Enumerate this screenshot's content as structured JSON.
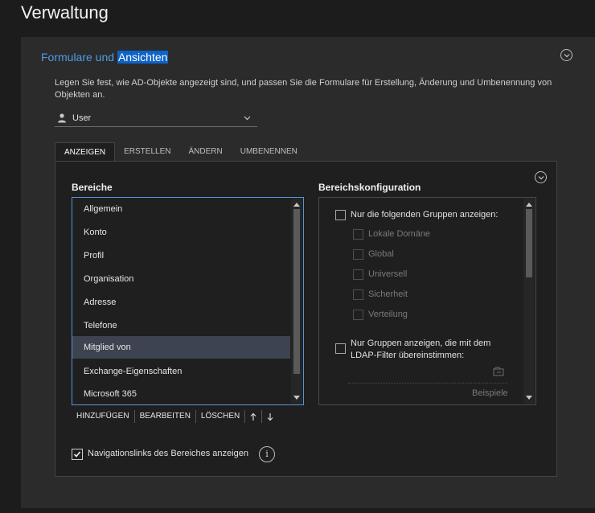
{
  "page": {
    "title": "Verwaltung"
  },
  "card": {
    "title_part1": "Formulare und ",
    "title_part2": "Ansichten",
    "description": "Legen Sie fest, wie AD-Objekte angezeigt sind, und passen Sie die Formulare für Erstellung, Änderung und Umbenennung von Objekten an.",
    "object_type": {
      "value": "User",
      "icon": "user-icon"
    }
  },
  "tabs": [
    {
      "label": "ANZEIGEN",
      "active": true
    },
    {
      "label": "ERSTELLEN",
      "active": false
    },
    {
      "label": "ÄNDERN",
      "active": false
    },
    {
      "label": "UMBENENNEN",
      "active": false
    }
  ],
  "sections": {
    "label": "Bereiche",
    "items": [
      {
        "label": "Allgemein",
        "selected": false
      },
      {
        "label": "Konto",
        "selected": false
      },
      {
        "label": "Profil",
        "selected": false
      },
      {
        "label": "Organisation",
        "selected": false
      },
      {
        "label": "Adresse",
        "selected": false
      },
      {
        "label": "Telefone",
        "selected": false
      },
      {
        "label": "Mitglied von",
        "selected": true
      },
      {
        "label": "Exchange-Eigenschaften",
        "selected": false
      },
      {
        "label": "Microsoft 365",
        "selected": false
      }
    ],
    "toolbar": {
      "add_label": "HINZUFÜGEN",
      "edit_label": "BEARBEITEN",
      "delete_label": "LÖSCHEN"
    }
  },
  "config": {
    "label": "Bereichskonfiguration",
    "only_groups_label": "Nur die folgenden Gruppen anzeigen:",
    "group_types": [
      {
        "label": "Lokale Domäne"
      },
      {
        "label": "Global"
      },
      {
        "label": "Universell"
      },
      {
        "label": "Sicherheit"
      },
      {
        "label": "Verteilung"
      }
    ],
    "ldap_label": "Nur Gruppen anzeigen, die mit dem LDAP-Filter übereinstimmen:",
    "examples_label": "Beispiele"
  },
  "navlinks": {
    "label": "Navigationslinks des Bereiches anzeigen",
    "checked": true
  },
  "colors": {
    "accent": "#4f9be8",
    "highlight": "#0e63c8",
    "selected_row": "#3d4350",
    "list_border": "#5a93d6"
  }
}
